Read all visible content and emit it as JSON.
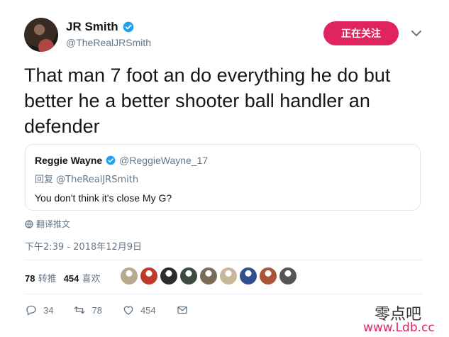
{
  "author": {
    "name": "JR Smith",
    "handle": "@TheRealJRSmith",
    "follow_label": "正在关注"
  },
  "tweet": {
    "text": "That man 7 foot an do everything he do but better he a better shooter ball handler an defender"
  },
  "quote": {
    "name": "Reggie Wayne",
    "handle": "@ReggieWayne_17",
    "reply_to": "回复 @TheRealJRSmith",
    "text": "You don't think it's close My G?"
  },
  "translate_label": "翻译推文",
  "timestamp": "下午2:39 - 2018年12月9日",
  "stats": {
    "retweets_count": "78",
    "retweets_label": "转推",
    "likes_count": "454",
    "likes_label": "喜欢"
  },
  "liker_colors": [
    "#b9a98f",
    "#c0392b",
    "#2c2c2c",
    "#3e4a3d",
    "#7d6b5a",
    "#c9b79c",
    "#2f4f8f",
    "#a8553a",
    "#555555"
  ],
  "actions": {
    "replies": "34",
    "retweets": "78",
    "likes": "454"
  },
  "watermark": {
    "text": "零点吧",
    "url": "www.Ldb.cc"
  },
  "colors": {
    "accent": "#e0245e",
    "verified": "#1da1f2",
    "muted": "#657786"
  }
}
